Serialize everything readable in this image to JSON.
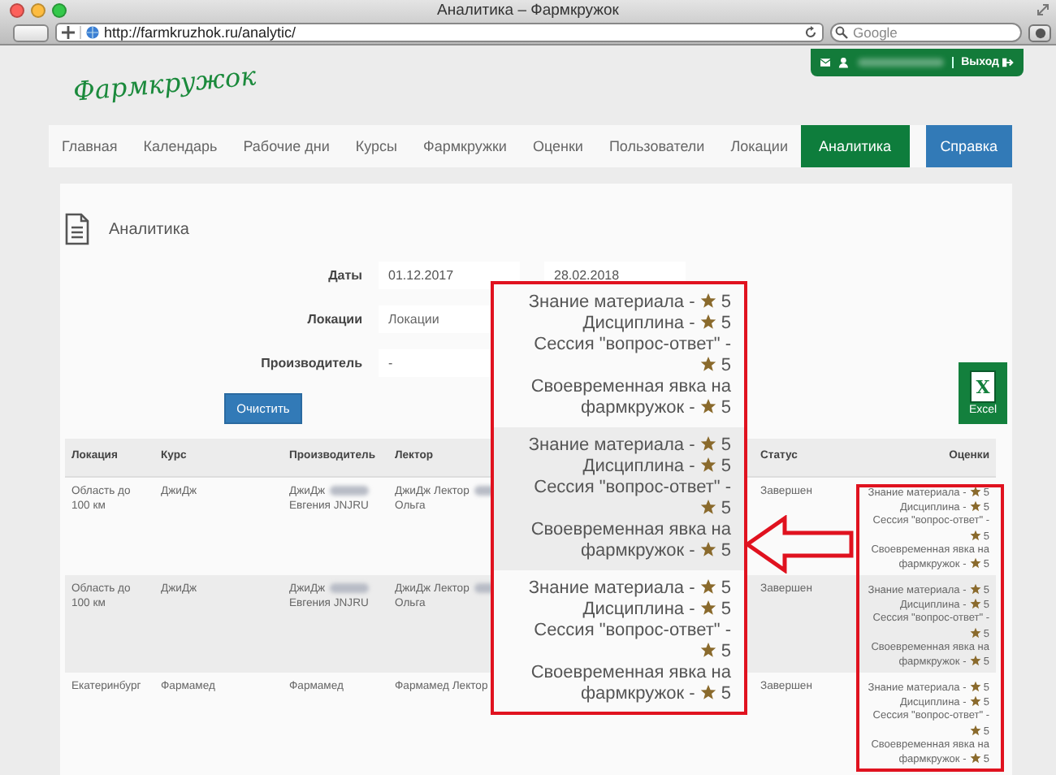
{
  "browser": {
    "title": "Аналитика – Фармкружок",
    "url": "http://farmkruzhok.ru/analytic/",
    "search": {
      "placeholder": "Google"
    }
  },
  "header": {
    "logo": "Фармкружок",
    "user_bar": {
      "logout": "Выход"
    }
  },
  "nav": {
    "items": [
      {
        "label": "Главная",
        "selected": false
      },
      {
        "label": "Календарь",
        "selected": false
      },
      {
        "label": "Рабочие дни",
        "selected": false
      },
      {
        "label": "Курсы",
        "selected": false
      },
      {
        "label": "Фармкружки",
        "selected": false
      },
      {
        "label": "Оценки",
        "selected": false
      },
      {
        "label": "Пользователи",
        "selected": false
      },
      {
        "label": "Локации",
        "selected": false
      },
      {
        "label": "Аналитика",
        "selected": true
      }
    ],
    "help": "Справка"
  },
  "panel": {
    "title": "Аналитика",
    "filters": [
      {
        "label": "Даты",
        "fields": [
          {
            "value": "01.12.2017"
          },
          {
            "value": "28.02.2018"
          }
        ]
      },
      {
        "label": "Локации",
        "fields": [
          {
            "placeholder": "Локации"
          }
        ]
      },
      {
        "label": "Производитель",
        "fields": [
          {
            "value": "-"
          }
        ]
      }
    ],
    "clear_button": "Очистить",
    "excel_button": {
      "glyph": "X",
      "label": "Excel"
    }
  },
  "table": {
    "columns": [
      "Локация",
      "Курс",
      "Производитель",
      "Лектор",
      "Статус",
      "Оценки"
    ],
    "rows": [
      {
        "location": "Область до 100 км",
        "course": "ДжиДж",
        "producer": [
          {
            "kind": "text",
            "text": "ДжиДж"
          },
          {
            "kind": "blurred"
          },
          {
            "kind": "text",
            "text": "Евгения JNJRU"
          }
        ],
        "lecturer": [
          {
            "kind": "text",
            "text": "ДжиДж Лектор"
          },
          {
            "kind": "blurred"
          },
          {
            "kind": "text",
            "text": "Ольга"
          }
        ],
        "status": "Завершен",
        "ratings": [
          {
            "lines": [
              "Знание материала -"
            ],
            "score": "5"
          },
          {
            "lines": [
              "Дисциплина -"
            ],
            "score": "5"
          },
          {
            "lines": [
              "Сессия \"вопрос-ответ\" -"
            ],
            "score": "5"
          },
          {
            "lines": [
              "Своевременная явка на",
              "фармкружок -"
            ],
            "score": "5"
          }
        ]
      },
      {
        "location": "Область до 100 км",
        "course": "ДжиДж",
        "producer": [
          {
            "kind": "text",
            "text": "ДжиДж"
          },
          {
            "kind": "blurred"
          },
          {
            "kind": "text",
            "text": "Евгения JNJRU"
          }
        ],
        "lecturer": [
          {
            "kind": "text",
            "text": "ДжиДж Лектор"
          },
          {
            "kind": "blurred"
          },
          {
            "kind": "text",
            "text": "Ольга"
          }
        ],
        "status": "Завершен",
        "ratings": [
          {
            "lines": [
              "Знание материала -"
            ],
            "score": "5"
          },
          {
            "lines": [
              "Дисциплина -"
            ],
            "score": "5"
          },
          {
            "lines": [
              "Сессия \"вопрос-ответ\" -"
            ],
            "score": "5"
          },
          {
            "lines": [
              "Своевременная явка на",
              "фармкружок -"
            ],
            "score": "5"
          }
        ]
      },
      {
        "location": "Екатеринбург",
        "course": "Фармамед",
        "producer": [
          {
            "kind": "text",
            "text": "Фармамед"
          }
        ],
        "lecturer": [
          {
            "kind": "text",
            "text": "Фармамед Лектор"
          }
        ],
        "status": "Завершен",
        "ratings": [
          {
            "lines": [
              "Знание материала -"
            ],
            "score": "5"
          },
          {
            "lines": [
              "Дисциплина -"
            ],
            "score": "5"
          },
          {
            "lines": [
              "Сессия \"вопрос-ответ\" -"
            ],
            "score": "5"
          },
          {
            "lines": [
              "Своевременная явка на",
              "фармкружок -"
            ],
            "score": "5"
          }
        ]
      }
    ]
  },
  "callout": {
    "rows": [
      {
        "ratings": [
          {
            "lines": [
              "Знание материала -"
            ],
            "score": "5"
          },
          {
            "lines": [
              "Дисциплина -"
            ],
            "score": "5"
          },
          {
            "lines": [
              "Сессия \"вопрос-ответ\" -"
            ],
            "score": "5"
          },
          {
            "lines": [
              "Своевременная явка на",
              "фармкружок -"
            ],
            "score": "5"
          }
        ]
      },
      {
        "ratings": [
          {
            "lines": [
              "Знание материала -"
            ],
            "score": "5"
          },
          {
            "lines": [
              "Дисциплина -"
            ],
            "score": "5"
          },
          {
            "lines": [
              "Сессия \"вопрос-ответ\" -"
            ],
            "score": "5"
          },
          {
            "lines": [
              "Своевременная явка на",
              "фармкружок -"
            ],
            "score": "5"
          }
        ]
      },
      {
        "ratings": [
          {
            "lines": [
              "Знание материала -"
            ],
            "score": "5"
          },
          {
            "lines": [
              "Дисциплина -"
            ],
            "score": "5"
          },
          {
            "lines": [
              "Сессия \"вопрос-ответ\" -"
            ],
            "score": "5"
          },
          {
            "lines": [
              "Своевременная явка на",
              "фармкружок -"
            ],
            "score": "5"
          }
        ]
      }
    ]
  }
}
